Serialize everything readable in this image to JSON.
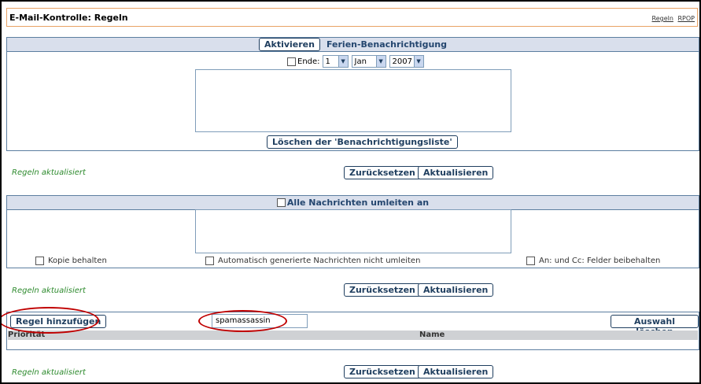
{
  "header": {
    "title": "E-Mail-Kontrolle: Regeln",
    "links": [
      "Regeln",
      "RPOP"
    ]
  },
  "vacation": {
    "activate_label": "Aktivieren",
    "title": "Ferien-Benachrichtigung",
    "end_label": "Ende:",
    "day": "1",
    "month": "Jan",
    "year": "2007",
    "clear_label": "Löschen der 'Benachrichtigungsliste'",
    "status": "Regeln aktualisiert",
    "reset_label": "Zurücksetzen",
    "update_label": "Aktualisieren"
  },
  "forward": {
    "title": "Alle Nachrichten umleiten an",
    "keep_copy": "Kopie behalten",
    "no_auto": "Automatisch generierte Nachrichten nicht umleiten",
    "keep_fields": "An: und Cc: Felder beibehalten",
    "status": "Regeln aktualisiert",
    "reset_label": "Zurücksetzen",
    "update_label": "Aktualisieren"
  },
  "rules": {
    "add_label": "Regel hinzufügen",
    "name_value": "spamassassin",
    "clear_selection_label": "Auswahl löschen",
    "columns": [
      "Priorität",
      "Name"
    ],
    "status": "Regeln aktualisiert",
    "reset_label": "Zurücksetzen",
    "update_label": "Aktualisieren"
  },
  "colors": {
    "border": "#5c7ea0",
    "header_bg": "#d9dfec",
    "status_green": "#2d8a2d",
    "annotation_red": "#c00000"
  }
}
